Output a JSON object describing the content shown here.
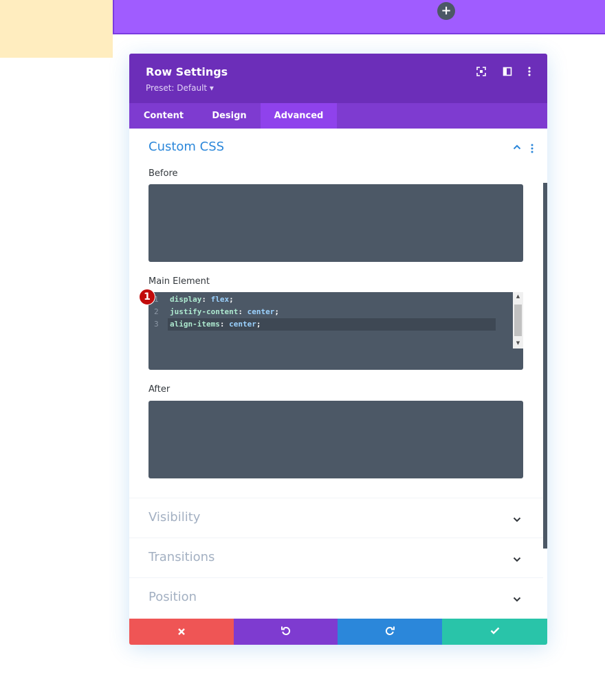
{
  "builder": {
    "add_button_glyph": "+"
  },
  "modal": {
    "title": "Row Settings",
    "preset_label": "Preset: Default ▾",
    "header_color": "#6c2eb9",
    "tabs_color": "#7e3bd0",
    "active_tab_color": "#8f42ec",
    "tabs": [
      {
        "label": "Content"
      },
      {
        "label": "Design"
      },
      {
        "label": "Advanced"
      }
    ],
    "active_tab": "Advanced"
  },
  "custom_css": {
    "title": "Custom CSS",
    "fields": {
      "before": {
        "label": "Before",
        "value": ""
      },
      "main": {
        "label": "Main Element",
        "lines": [
          {
            "num": "1",
            "prop": "display",
            "value": "flex"
          },
          {
            "num": "2",
            "prop": "justify-content",
            "value": "center"
          },
          {
            "num": "3",
            "prop": "align-items",
            "value": "center"
          }
        ]
      },
      "after": {
        "label": "After",
        "value": ""
      }
    }
  },
  "annotation": {
    "badge_number": "1"
  },
  "collapsed_sections": [
    {
      "title": "Visibility"
    },
    {
      "title": "Transitions"
    },
    {
      "title": "Position"
    }
  ],
  "footer": {
    "cancel_color": "#ef5555",
    "undo_color": "#7e3bd0",
    "redo_color": "#2b87da",
    "save_color": "#29c4a9"
  }
}
